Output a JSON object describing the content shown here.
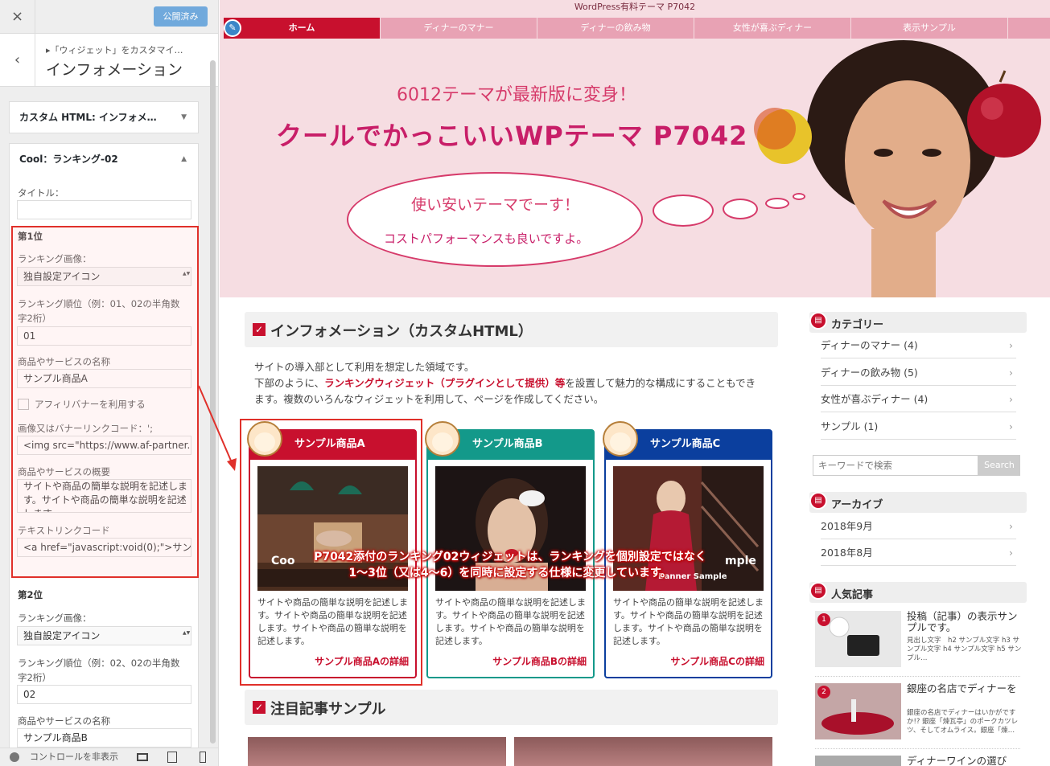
{
  "customizer": {
    "close_icon": "×",
    "publish_label": "公開済み",
    "back_icon": "‹",
    "breadcrumb": "▸「ウィジェット」をカスタマイ…",
    "title": "インフォメーション",
    "widgets": [
      {
        "title": "カスタム HTML: インフォメ…",
        "arrow": "▼"
      },
      {
        "title": "Cool：ランキング-02",
        "arrow": "▲"
      }
    ],
    "form": {
      "title_label": "タイトル：",
      "title_value": "",
      "rank1": {
        "section": "第1位",
        "image_label": "ランキング画像：",
        "image_value": "独自設定アイコン",
        "order_label": "ランキング順位（例：01、02の半角数字2桁）",
        "order_value": "01",
        "name_label": "商品やサービスの名称",
        "name_value": "サンプル商品A",
        "affiliate_label": "アフィリバナーを利用する",
        "banner_label": "画像又はバナーリンクコード：';",
        "banner_value": "<img src=\"https://www.af-partner.",
        "summary_label": "商品やサービスの概要",
        "summary_value": "サイトや商品の簡単な説明を記述します。サイトや商品の簡単な説明を記述します。",
        "textlink_label": "テキストリンクコード",
        "textlink_value": "<a href=\"javascript:void(0);\">サン"
      },
      "rank2": {
        "section": "第2位",
        "image_label": "ランキング画像：",
        "image_value": "独自設定アイコン",
        "order_label": "ランキング順位（例：02、02の半角数字2桁）",
        "order_value": "02",
        "name_label": "商品やサービスの名称",
        "name_value": "サンプル商品B"
      }
    },
    "bottom_label": "コントロールを非表示",
    "device_icons": [
      "desktop-icon",
      "tablet-icon",
      "mobile-icon"
    ]
  },
  "site": {
    "top_title": "WordPress有料テーマ P7042",
    "nav": [
      "ホーム",
      "ディナーのマナー",
      "ディナーの飲み物",
      "女性が喜ぶディナー",
      "表示サンプル"
    ],
    "hero": {
      "subtitle": "6012テーマが最新版に変身！",
      "title": "クールでかっこいいWPテーマ P7042",
      "bubble_line1": "使い安いテーマでーす！",
      "bubble_line2": "コストパフォーマンスも良いですよ。"
    },
    "info": {
      "heading": "インフォメーション（カスタムHTML）",
      "line1": "サイトの導入部として利用を想定した領域です。",
      "line2_pre": "下部のように、",
      "line2_hl": "ランキングウィジェット（プラグインとして提供）等",
      "line2_post": "を設置して魅力的な構成にすることもでき",
      "line3": "ます。複数のいろんなウィジェットを利用して、ページを作成してください。"
    },
    "cards": [
      {
        "title": "サンプル商品A",
        "color": "#c8102e",
        "desc": "サイトや商品の簡単な説明を記述します。サイトや商品の簡単な説明を記述します。サイトや商品の簡単な説明を記述します。",
        "more": "サンプル商品Aの詳細"
      },
      {
        "title": "サンプル商品B",
        "color": "#13998a",
        "desc": "サイトや商品の簡単な説明を記述します。サイトや商品の簡単な説明を記述します。サイトや商品の簡単な説明を記述します。",
        "more": "サンプル商品Bの詳細"
      },
      {
        "title": "サンプル商品C",
        "color": "#0b3f9e",
        "desc": "サイトや商品の簡単な説明を記述します。サイトや商品の簡単な説明を記述します。サイトや商品の簡単な説明を記述します。",
        "more": "サンプル商品Cの詳細"
      }
    ],
    "banner_text_a": "Coo",
    "banner_text_b": "Banner Sample",
    "banner_text_c": "mple",
    "annotation_line1": "P7042添付のランキング02ウィジェットは、ランキングを個別設定ではなく",
    "annotation_line2": "1〜3位（又は4〜6）を同時に設定する仕様に変更しています。",
    "featured_heading": "注目記事サンプル",
    "sidebar": {
      "category_title": "カテゴリー",
      "categories": [
        "ディナーのマナー (4)",
        "ディナーの飲み物 (5)",
        "女性が喜ぶディナー (4)",
        "サンプル (1)"
      ],
      "search_placeholder": "キーワードで検索",
      "search_button": "Search",
      "archive_title": "アーカイブ",
      "archives": [
        "2018年9月",
        "2018年8月"
      ],
      "popular_title": "人気記事",
      "popular": [
        {
          "num": "1",
          "title": "投稿（記事）の表示サンプルです。",
          "desc": "見出し文字　h2 サンプル文字 h3 サンプル文字 h4 サンプル文字 h5 サンプル…"
        },
        {
          "num": "2",
          "title": "銀座の名店でディナーを",
          "desc": "銀座の名店でディナーはいかがですか!? 銀座「煉瓦亭」のポークカツレツ、そしてオムライス。銀座「煉…"
        }
      ],
      "popular3_title": "ディナーワインの選び"
    }
  }
}
